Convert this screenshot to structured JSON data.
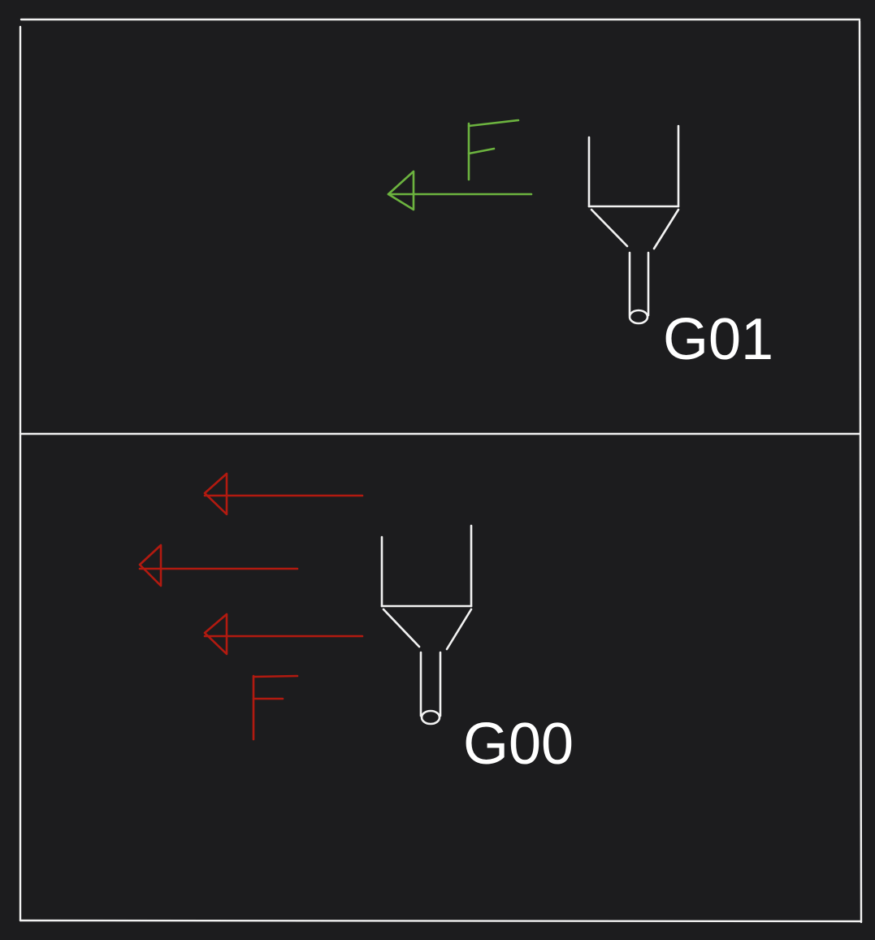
{
  "colors": {
    "background": "#1c1c1e",
    "frame": "#f2f2f2",
    "tool": "#f2f2f2",
    "g01_feed": "#6cb33f",
    "g00_rapid": "#b21a10"
  },
  "panels": [
    {
      "id": "g01",
      "code": "G01",
      "feed_letter": "F",
      "arrow_count": 1,
      "arrow_color": "#6cb33f"
    },
    {
      "id": "g00",
      "code": "G00",
      "feed_letter": "F",
      "arrow_count": 3,
      "arrow_color": "#b21a10"
    }
  ]
}
